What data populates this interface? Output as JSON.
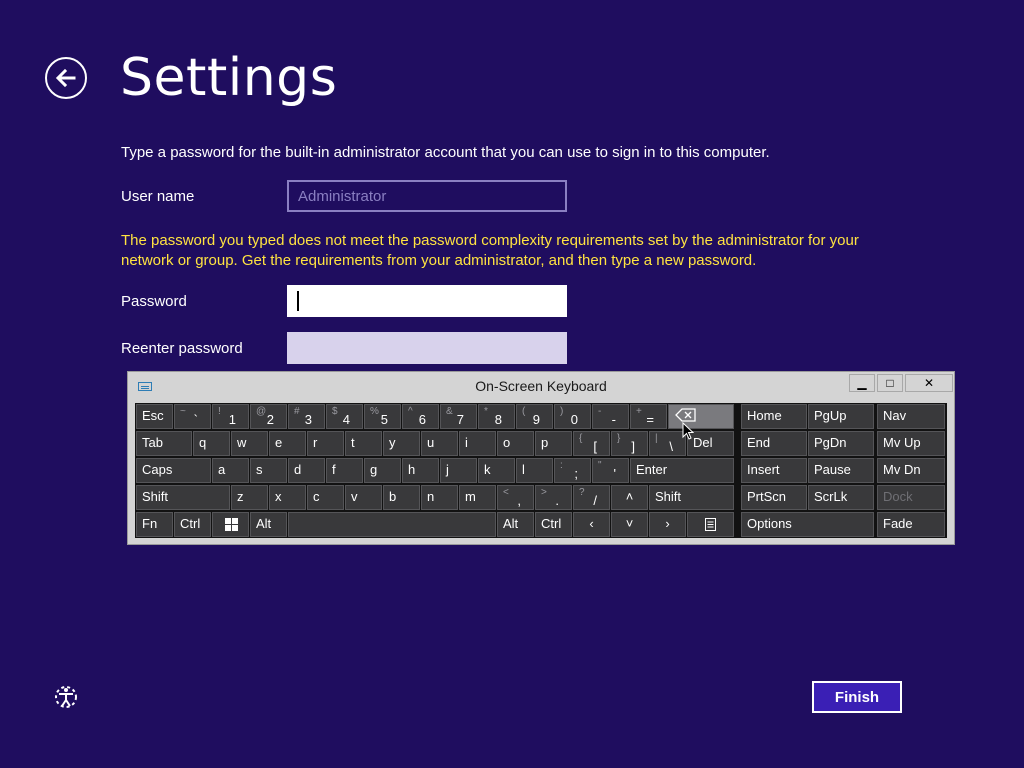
{
  "page": {
    "title": "Settings",
    "instruction": "Type a password for the built-in administrator account that you can use to sign in to this computer.",
    "username_label": "User name",
    "username_placeholder": "Administrator",
    "error": "The password you typed does not meet the password complexity requirements set by the administrator for your network or group. Get the requirements from your administrator, and then type a new password.",
    "password_label": "Password",
    "password_value": "",
    "reenter_label": "Reenter password",
    "reenter_value": "",
    "finish_label": "Finish"
  },
  "colors": {
    "background": "#1f0d5f",
    "error_text": "#ffe341",
    "finish_button": "#3a1fb5"
  },
  "icons": {
    "back": "back-arrow-icon",
    "ease_of_access": "ease-of-access-icon",
    "keyboard": "keyboard-icon",
    "windows": "windows-logo-icon",
    "backspace": "backspace-icon",
    "menu": "context-menu-icon"
  },
  "osk": {
    "title": "On-Screen Keyboard",
    "controls": {
      "minimize": "▁",
      "maximize": "□",
      "close": "✕"
    },
    "keys": {
      "esc": "Esc",
      "tilde": {
        "sec": "~",
        "pri": "`"
      },
      "d1": {
        "sec": "!",
        "pri": "1"
      },
      "d2": {
        "sec": "@",
        "pri": "2"
      },
      "d3": {
        "sec": "#",
        "pri": "3"
      },
      "d4": {
        "sec": "$",
        "pri": "4"
      },
      "d5": {
        "sec": "%",
        "pri": "5"
      },
      "d6": {
        "sec": "^",
        "pri": "6"
      },
      "d7": {
        "sec": "&",
        "pri": "7"
      },
      "d8": {
        "sec": "*",
        "pri": "8"
      },
      "d9": {
        "sec": "(",
        "pri": "9"
      },
      "d0": {
        "sec": ")",
        "pri": "0"
      },
      "minus": {
        "sec": "-",
        "pri": "-"
      },
      "equals": {
        "sec": "+",
        "pri": "="
      },
      "home": "Home",
      "pgup": "PgUp",
      "nav": "Nav",
      "tab": "Tab",
      "q": "q",
      "w": "w",
      "e": "e",
      "r": "r",
      "t": "t",
      "y": "y",
      "u": "u",
      "i": "i",
      "o": "o",
      "p": "p",
      "lbracket": {
        "sec": "{",
        "pri": "["
      },
      "rbracket": {
        "sec": "}",
        "pri": "]"
      },
      "backslash": {
        "sec": "|",
        "pri": "\\"
      },
      "del": "Del",
      "end": "End",
      "pgdn": "PgDn",
      "mvup": "Mv Up",
      "caps": "Caps",
      "a": "a",
      "s": "s",
      "d": "d",
      "f": "f",
      "g": "g",
      "h": "h",
      "j": "j",
      "k": "k",
      "l": "l",
      "semicolon": {
        "sec": ":",
        "pri": ";"
      },
      "quote": {
        "sec": "\"",
        "pri": "'"
      },
      "enter": "Enter",
      "insert": "Insert",
      "pause": "Pause",
      "mvdn": "Mv Dn",
      "lshift": "Shift",
      "z": "z",
      "x": "x",
      "c": "c",
      "v": "v",
      "b": "b",
      "n": "n",
      "m": "m",
      "comma": {
        "sec": "<",
        "pri": ","
      },
      "period": {
        "sec": ">",
        "pri": "."
      },
      "slash": {
        "sec": "?",
        "pri": "/"
      },
      "up": "˄",
      "rshift": "Shift",
      "prtscn": "PrtScn",
      "scrlk": "ScrLk",
      "dock": "Dock",
      "fn": "Fn",
      "lctrl": "Ctrl",
      "lalt": "Alt",
      "ralt": "Alt",
      "rctrl": "Ctrl",
      "left": "‹",
      "down": "˅",
      "right": "›",
      "options": "Options",
      "fade": "Fade"
    }
  }
}
